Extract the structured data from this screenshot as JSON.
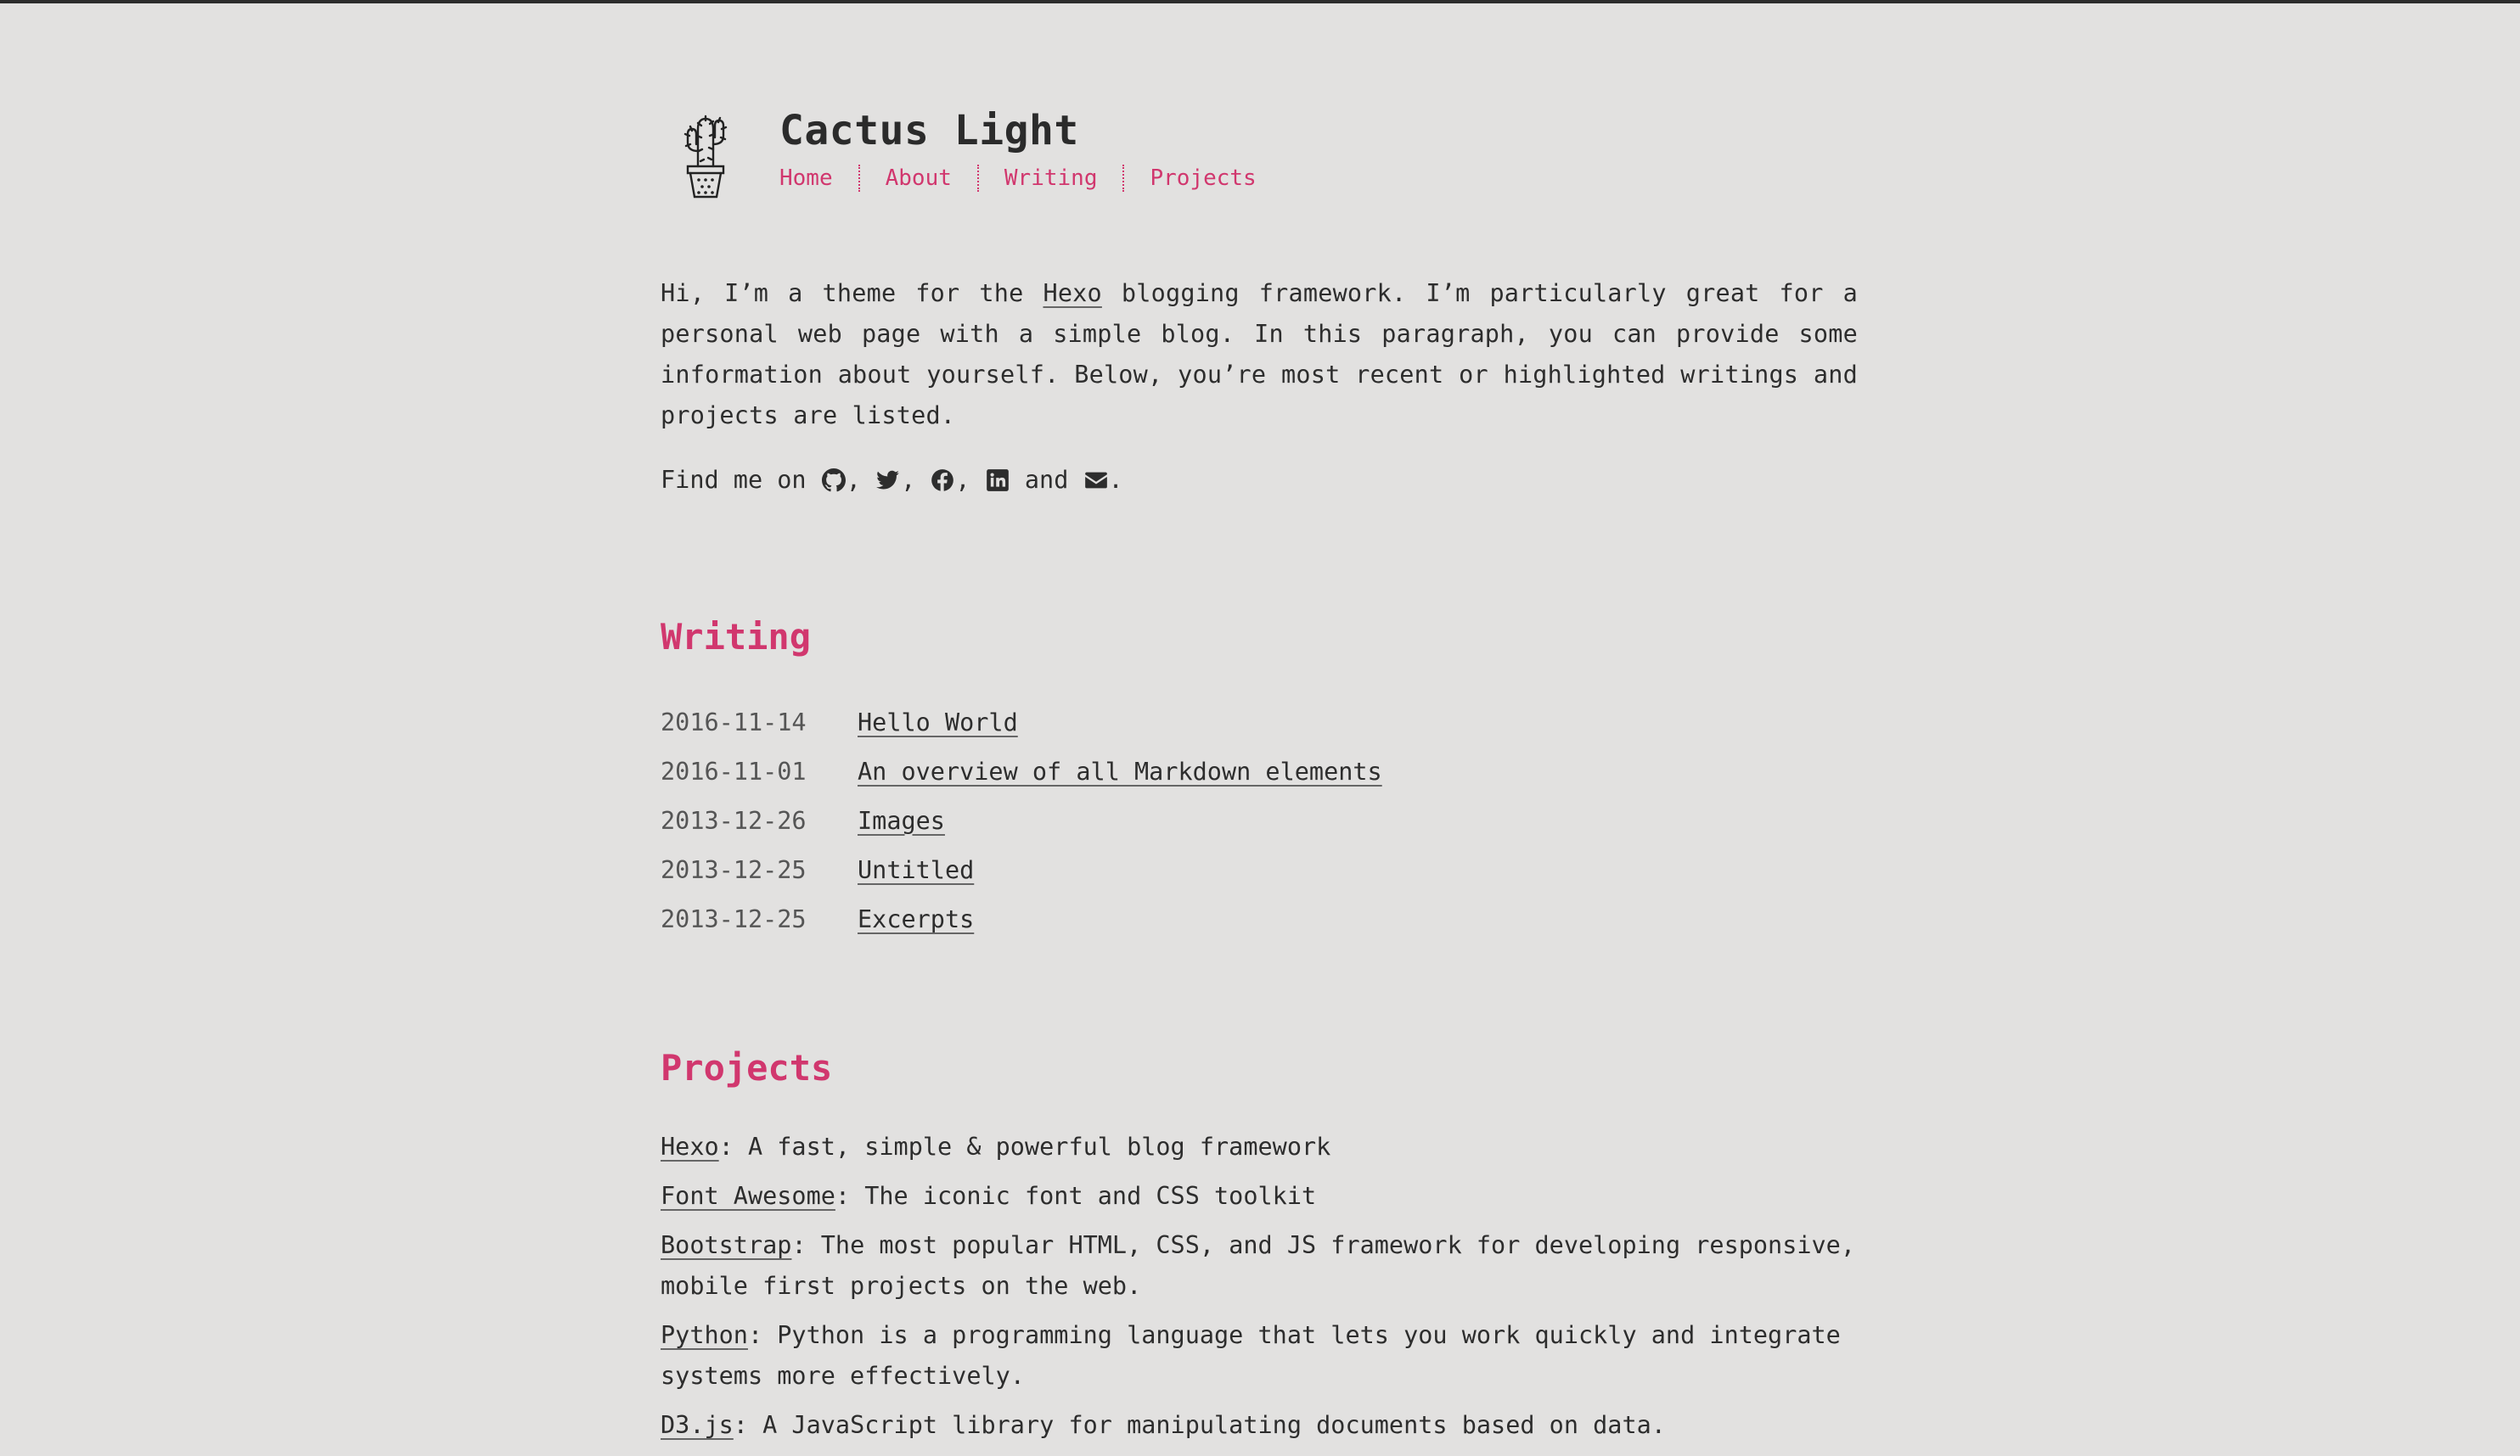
{
  "site": {
    "title": "Cactus Light"
  },
  "nav": [
    {
      "label": "Home"
    },
    {
      "label": "About"
    },
    {
      "label": "Writing"
    },
    {
      "label": "Projects"
    }
  ],
  "intro": {
    "before_link": "Hi, I’m a theme for the ",
    "link": "Hexo",
    "after_link": " blogging framework. I’m particularly great for a personal web page with a simple blog. In this paragraph, you can provide some information about yourself. Below, you’re most recent or highlighted writings and projects are listed."
  },
  "findme": {
    "prefix": "Find me on ",
    "and": " and ",
    "comma": ", ",
    "period": ".",
    "icons": [
      "github-icon",
      "twitter-icon",
      "facebook-icon",
      "linkedin-icon",
      "envelope-icon"
    ]
  },
  "writing": {
    "title": "Writing",
    "posts": [
      {
        "date": "2016-11-14",
        "title": "Hello World"
      },
      {
        "date": "2016-11-01",
        "title": "An overview of all Markdown elements"
      },
      {
        "date": "2013-12-26",
        "title": "Images"
      },
      {
        "date": "2013-12-25",
        "title": "Untitled"
      },
      {
        "date": "2013-12-25",
        "title": "Excerpts"
      }
    ]
  },
  "projects": {
    "title": "Projects",
    "items": [
      {
        "name": "Hexo",
        "desc": ": A fast, simple & powerful blog framework"
      },
      {
        "name": "Font Awesome",
        "desc": ": The iconic font and CSS toolkit"
      },
      {
        "name": "Bootstrap",
        "desc": ": The most popular HTML, CSS, and JS framework for developing responsive, mobile first projects on the web."
      },
      {
        "name": "Python",
        "desc": ": Python is a programming language that lets you work quickly and integrate systems more effectively."
      },
      {
        "name": "D3.js",
        "desc": ": A JavaScript library for manipulating documents based on data."
      }
    ]
  },
  "colors": {
    "background": "#e2e1e0",
    "text": "#2d2d2d",
    "accent": "#d1376e"
  }
}
